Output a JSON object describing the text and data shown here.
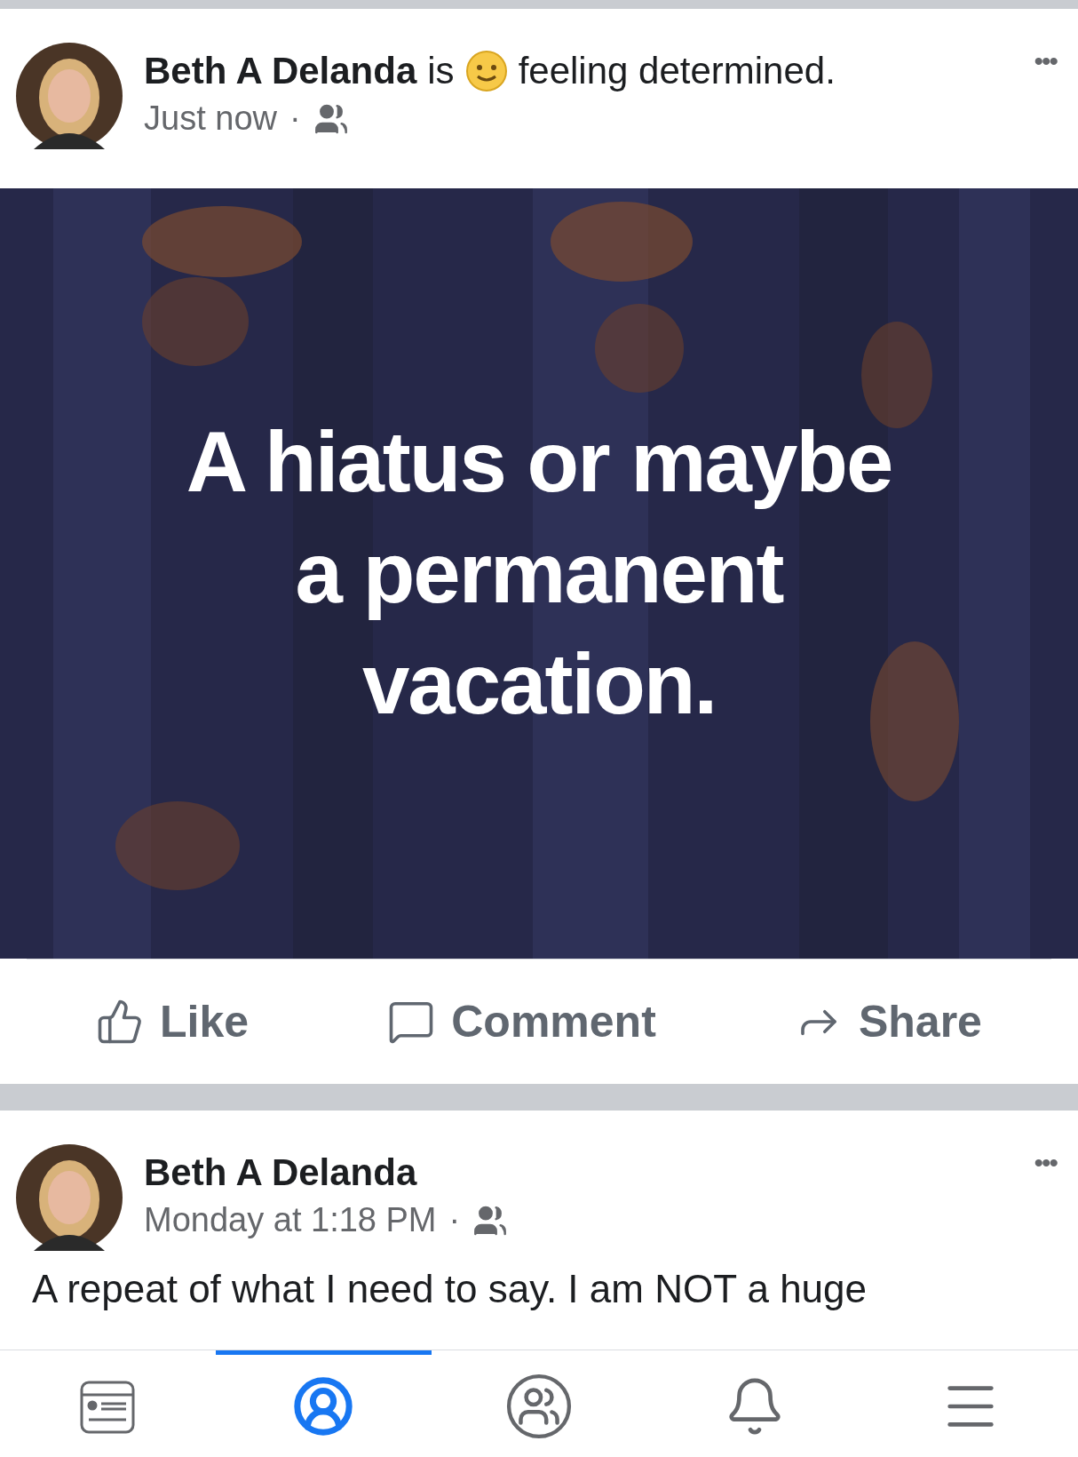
{
  "posts": [
    {
      "kind": "background",
      "author": "Beth A Delanda",
      "status_verb": "is",
      "feeling": "feeling determined.",
      "time": "Just now",
      "separator": "·",
      "more": "•••",
      "background_text": "A hiatus or maybe a permanent vacation.",
      "actions": [
        "Like",
        "Comment",
        "Share"
      ]
    },
    {
      "kind": "text",
      "author": "Beth A Delanda",
      "time": "Monday at 1:18 PM",
      "separator": "·",
      "more": "•••",
      "text": "A repeat of what I need to say. I am NOT a huge"
    }
  ],
  "tabs": [
    {
      "kind": "feed",
      "selected": false
    },
    {
      "kind": "profile",
      "selected": true
    },
    {
      "kind": "groups",
      "selected": false
    },
    {
      "kind": "notifications",
      "selected": false
    },
    {
      "kind": "menu",
      "selected": false
    }
  ]
}
